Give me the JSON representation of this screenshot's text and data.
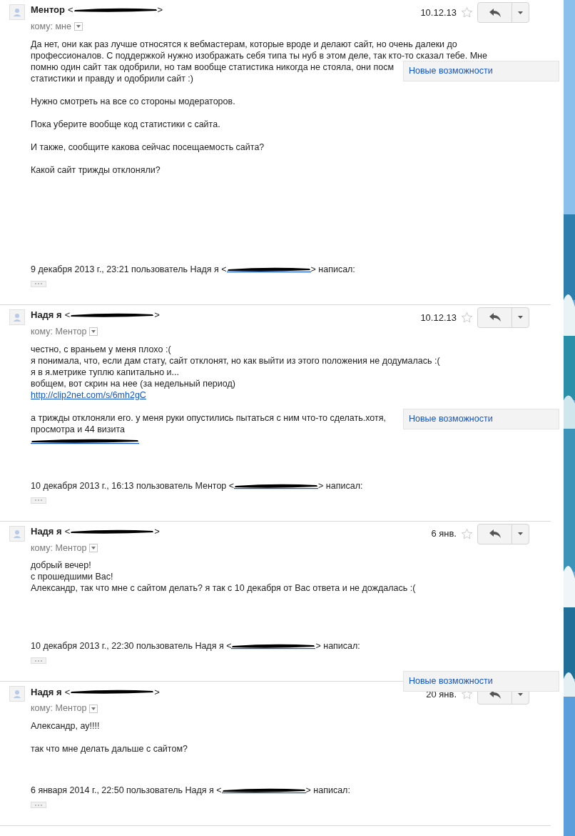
{
  "messages": [
    {
      "sender": "Ментор",
      "email_open": "<",
      "email_close": ">",
      "date": "10.12.13",
      "starred": false,
      "to_label": "кому: мне",
      "paragraphs": [
        [
          {
            "kind": "text",
            "text": "Да нет, они как раз лучше относятся к вебмастерам, которые вроде и делают сайт, но очень далеки до"
          },
          {
            "kind": "text",
            "text": "профессионалов. С поддержкой нужно изображать себя типа ты нуб в этом деле, так кто-то сказал тебе. Мне"
          },
          {
            "kind": "text",
            "text": "помню один сайт так одобрили, но там вообще статистика никогда не стояла, они посм"
          },
          {
            "kind": "text",
            "text": "статистики и правду и одобрили сайт :)"
          }
        ],
        [
          {
            "kind": "text",
            "text": "Нужно смотреть на все со стороны модераторов."
          }
        ],
        [
          {
            "kind": "text",
            "text": "Пока уберите вообще код статистики с сайта."
          }
        ],
        [
          {
            "kind": "text",
            "text": "И также, сообщите какова сейчас посещаемость сайта?"
          }
        ],
        [
          {
            "kind": "text",
            "text": "Какой сайт трижды отклоняли?"
          }
        ]
      ],
      "quote": {
        "before": "9 декабря 2013 г., 23:21 пользователь Надя я <",
        "after": "> написал:"
      },
      "popup": {
        "label": "Новые возможности"
      }
    },
    {
      "sender": "Надя я",
      "email_open": "<",
      "email_close": ">",
      "date": "10.12.13",
      "starred": false,
      "to_label": "кому: Ментор",
      "paragraphs": [
        [
          {
            "kind": "text",
            "text": "честно, с враньем у меня плохо :("
          },
          {
            "kind": "text",
            "text": "я понимала, что, если дам стату, сайт отклонят, но как выйти из этого положения не додумалась :("
          },
          {
            "kind": "text",
            "text": "я в я.метрике туплю капитально и..."
          },
          {
            "kind": "text",
            "text": "вобщем, вот скрин на нее (за недельный период)"
          },
          {
            "kind": "link",
            "text": "http://clip2net.com/s/6mh2gC"
          }
        ],
        [
          {
            "kind": "text",
            "text": "а трижды отклоняли его. у меня руки опустились пытаться с ним что-то сделать.хотя,"
          },
          {
            "kind": "text",
            "text": "просмотра и 44 визита"
          },
          {
            "kind": "redacted_link"
          }
        ]
      ],
      "quote": {
        "before": "10 декабря 2013 г., 16:13 пользователь Ментор <",
        "after": "> написал:"
      },
      "popup": {
        "label": "Новые возможности"
      }
    },
    {
      "sender": "Надя я",
      "email_open": "<",
      "email_close": ">",
      "date": "6 янв.",
      "starred": false,
      "to_label": "кому: Ментор",
      "paragraphs": [
        [
          {
            "kind": "text",
            "text": "добрый вечер!"
          },
          {
            "kind": "text",
            "text": "с прошедшими Вас!"
          },
          {
            "kind": "text",
            "text": "Александр, так что мне с сайтом делать? я так с 10 декабря от Вас ответа и не дождалась :("
          }
        ]
      ],
      "quote": {
        "before": "10 декабря 2013 г., 22:30 пользователь Надя я <",
        "after": "> написал:"
      }
    },
    {
      "sender": "Надя я",
      "email_open": "<",
      "email_close": ">",
      "date": "20 янв.",
      "starred": false,
      "to_label": "кому: Ментор",
      "paragraphs": [
        [
          {
            "kind": "text",
            "text": "Александр, ау!!!!"
          }
        ],
        [
          {
            "kind": "text",
            "text": "так что мне делать дальше с сайтом?"
          }
        ]
      ],
      "quote": {
        "before": "6 января 2014 г., 22:50 пользователь Надя я <",
        "after": "> написал:"
      },
      "popup": {
        "label": "Новые возможности"
      }
    }
  ]
}
